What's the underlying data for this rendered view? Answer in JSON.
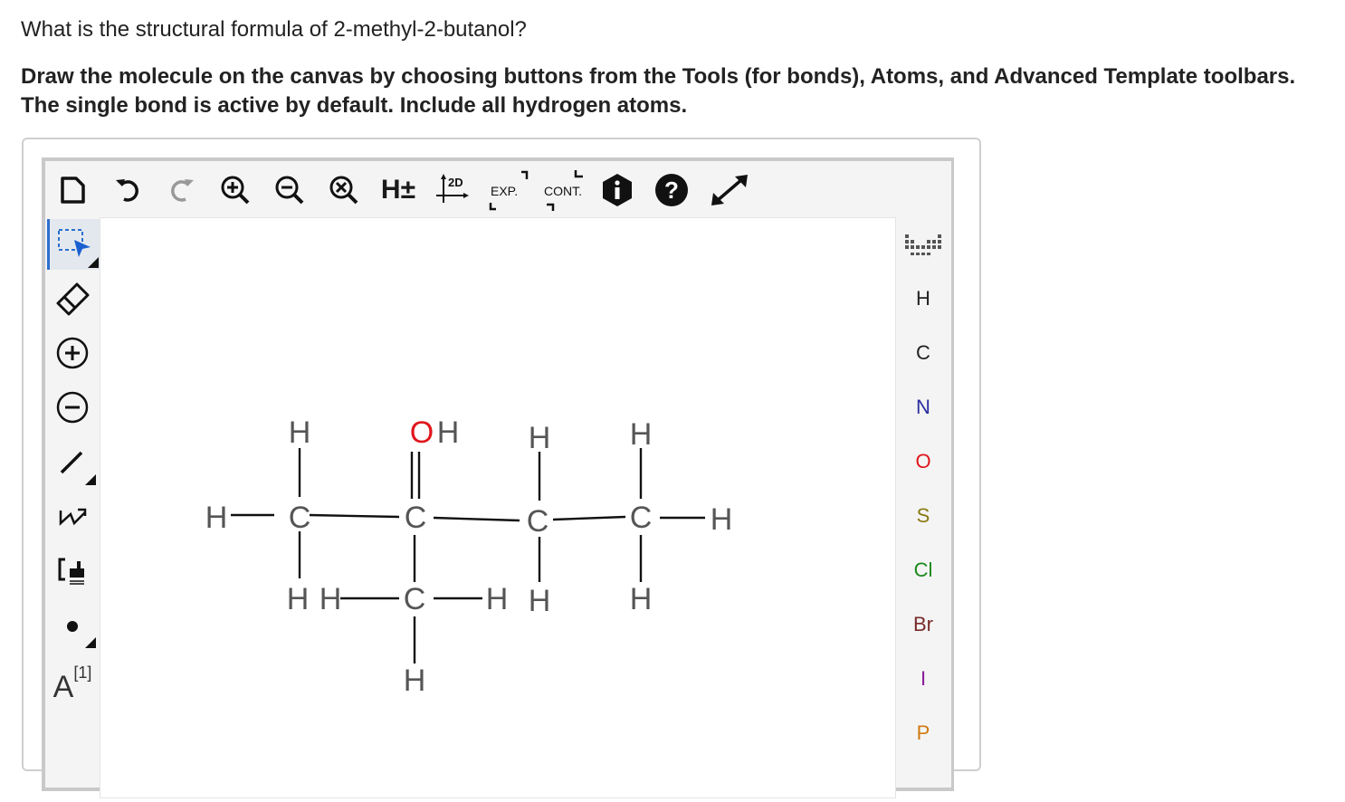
{
  "question": "What is the structural formula of 2-methyl-2-butanol?",
  "instructions": "Draw the molecule on the canvas by choosing buttons from the Tools (for bonds), Atoms, and Advanced Template toolbars. The single bond is active by default. Include all hydrogen atoms.",
  "top_toolbar": {
    "new": "document-icon",
    "undo": "undo-icon",
    "redo": "redo-icon",
    "zoom_in": "zoom-in-icon",
    "zoom_out": "zoom-out-icon",
    "zoom_reset": "zoom-reset-icon",
    "h_toggle_label": "H±",
    "clean2d_label": "2D",
    "expand_label": "EXP.",
    "contract_label": "CONT.",
    "info": "info-icon",
    "help": "help-icon",
    "fullscreen": "fullscreen-icon"
  },
  "left_toolbar": {
    "select": "select-icon",
    "erase": "eraser-icon",
    "charge_plus": "charge-plus-icon",
    "charge_minus": "charge-minus-icon",
    "single_bond": "bond-icon",
    "chain": "chain-icon",
    "template": "template-icon",
    "radical": "radical-icon",
    "atom_map_label": "A",
    "atom_map_sup": "[1]"
  },
  "atoms": [
    {
      "symbol": "H",
      "color": "#222222"
    },
    {
      "symbol": "C",
      "color": "#222222"
    },
    {
      "symbol": "N",
      "color": "#2b2f9e"
    },
    {
      "symbol": "O",
      "color": "#e0161c"
    },
    {
      "symbol": "S",
      "color": "#8a7a12"
    },
    {
      "symbol": "Cl",
      "color": "#1a8a1a"
    },
    {
      "symbol": "Br",
      "color": "#7a2a2a"
    },
    {
      "symbol": "I",
      "color": "#8a1a9a"
    },
    {
      "symbol": "P",
      "color": "#d07a10"
    }
  ],
  "molecule": {
    "labels": {
      "h_top1": "H",
      "oh_o": "O",
      "oh_h": "H",
      "h_top3": "H",
      "h_top4": "H",
      "h_left": "H",
      "c1": "C",
      "c2": "C",
      "c3": "C",
      "c4": "C",
      "h_right": "H",
      "h_bot1": "H",
      "h_bot_ml": "H",
      "c_methyl": "C",
      "h_bot_mr": "H",
      "h_bot3": "H",
      "h_bot4": "H",
      "h_methyl_bottom": "H"
    },
    "oxygen_color": "#e0161c"
  }
}
